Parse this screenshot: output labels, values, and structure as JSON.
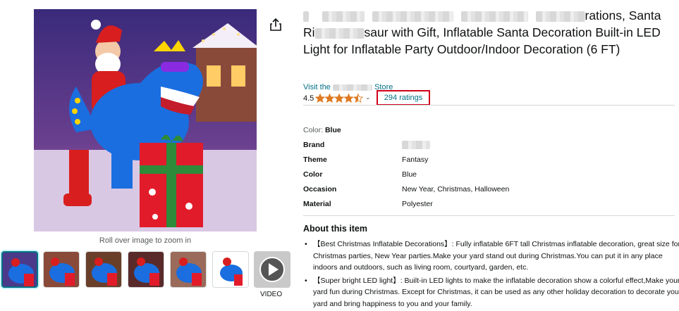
{
  "product": {
    "title_part1": "saur with Gift, Inflatable Santa Decoration Built-in LED Light for Inflatable Party Outdoor/Indoor Decoration (6 FT)",
    "title_fragment_a": "rations, Santa",
    "title_fragment_b": "Ri",
    "store_link": "Visit the",
    "store_suffix": "Store",
    "rating_value": "4.5",
    "stars": 4.5,
    "ratings_count": "294 ratings",
    "color_label": "Color:",
    "color_value": "Blue"
  },
  "specs": [
    {
      "key": "Brand",
      "value": ""
    },
    {
      "key": "Theme",
      "value": "Fantasy"
    },
    {
      "key": "Color",
      "value": "Blue"
    },
    {
      "key": "Occasion",
      "value": "New Year, Christmas, Halloween"
    },
    {
      "key": "Material",
      "value": "Polyester"
    }
  ],
  "about": {
    "title": "About this item",
    "bullets": [
      "【Best Christmas Inflatable Decorations】: Fully inflatable 6FT tall Christmas inflatable decoration, great size for Christmas parties, New Year parties.Make your yard stand out during Christmas.You can put it in any place indoors and outdoors, such as living room, courtyard, garden, etc.",
      "【Super bright LED light】: Built-in LED lights to make the inflatable decoration show a colorful effect,Make your yard fun during Christmas. Except for Christmas, it can be used as any other holiday decoration to decorate your yard and bring happiness to you and your family."
    ]
  },
  "gallery": {
    "zoom_hint": "Roll over image to zoom in",
    "video_label": "VIDEO",
    "thumbnail_count": 7
  },
  "colors": {
    "link": "#007185",
    "highlight_box": "#d0021b",
    "star": "#de7921"
  }
}
